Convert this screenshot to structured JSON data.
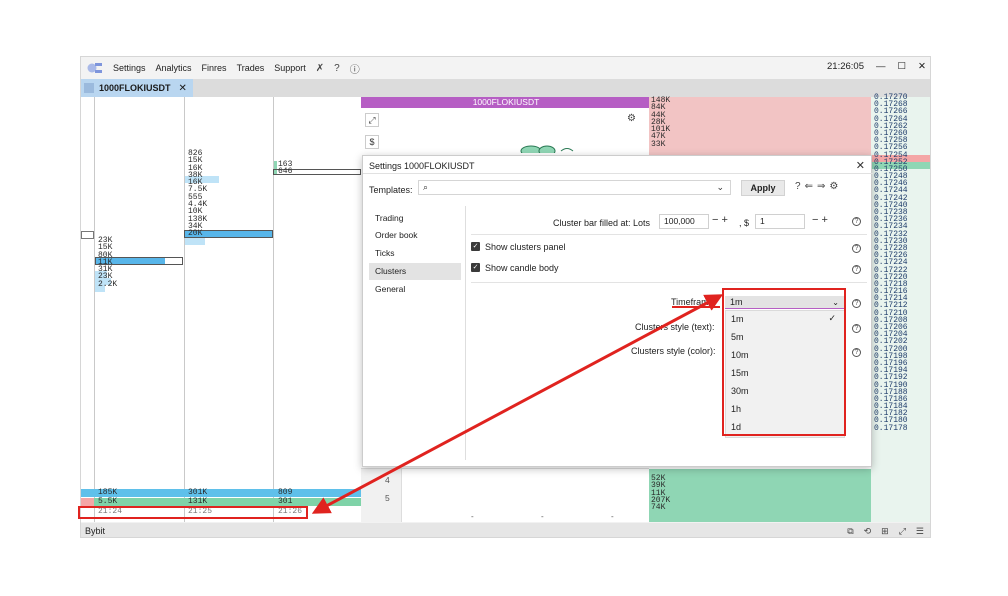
{
  "menu": {
    "items": [
      "Settings",
      "Analytics",
      "Finres",
      "Trades",
      "Support"
    ],
    "clock": "21:26:05"
  },
  "tab": {
    "label": "1000FLOKIUSDT"
  },
  "clusters": {
    "col1": [
      "23K",
      "15K",
      "80K",
      "11K",
      "31K",
      "23K",
      "2.2K"
    ],
    "col2": [
      "826",
      "15K",
      "16K",
      "38K",
      "16K",
      "7.5K",
      "555",
      "4.4K",
      "10K",
      "138K",
      "34K",
      "20K"
    ],
    "col3": [
      "163",
      "646"
    ],
    "bottom_row1": [
      "185K",
      "301K",
      "809"
    ],
    "bottom_row2": [
      "5.5K",
      "131K",
      "301"
    ],
    "times": [
      "21:24",
      "21:25",
      "21:26"
    ]
  },
  "chart": {
    "title": "1000FLOKIUSDT",
    "dollar": "$",
    "rows": [
      "4",
      "5"
    ],
    "dashes": [
      "-",
      "-",
      "-"
    ]
  },
  "book": {
    "top": [
      "148K",
      "84K",
      "44K",
      "28K",
      "101K",
      "47K",
      "33K"
    ],
    "bottom": [
      "52K",
      "39K",
      "11K",
      "207K",
      "74K"
    ]
  },
  "prices": [
    "0.17270",
    "0.17268",
    "0.17266",
    "0.17264",
    "0.17262",
    "0.17260",
    "0.17258",
    "0.17256",
    "0.17254",
    "0.17252",
    "0.17250",
    "0.17248",
    "0.17246",
    "0.17244",
    "0.17242",
    "0.17240",
    "0.17238",
    "0.17236",
    "0.17234",
    "0.17232",
    "0.17230",
    "0.17228",
    "0.17226",
    "0.17224",
    "0.17222",
    "0.17220",
    "0.17218",
    "0.17216",
    "0.17214",
    "0.17212",
    "0.17210",
    "0.17208",
    "0.17206",
    "0.17204",
    "0.17202",
    "0.17200",
    "0.17198",
    "0.17196",
    "0.17194",
    "0.17192",
    "0.17190",
    "0.17188",
    "0.17186",
    "0.17184",
    "0.17182",
    "0.17180",
    "0.17178"
  ],
  "settings": {
    "title": "Settings 1000FLOKIUSDT",
    "templates_label": "Templates:",
    "apply_label": "Apply",
    "nav": [
      "Trading",
      "Order book",
      "Ticks",
      "Clusters",
      "General"
    ],
    "cluster_bar_label": "Cluster bar filled at: Lots",
    "lots_value": "100,000",
    "dollar_label": ", $",
    "dollar_value": "1",
    "show_clusters_panel": "Show clusters panel",
    "show_candle_body": "Show candle body",
    "timeframe_label": "Timeframe:",
    "timeframe_value": "1m",
    "clusters_style_text": "Clusters style (text):",
    "clusters_style_color": "Clusters style (color):",
    "timeframe_options": [
      "1m",
      "5m",
      "10m",
      "15m",
      "30m",
      "1h",
      "1d"
    ]
  },
  "status": {
    "exchange": "Bybit"
  },
  "colors": {
    "accent": "#b65ec4",
    "highlight": "#e0231f",
    "bid": "#8fd6b4",
    "ask": "#f2c4c4"
  }
}
